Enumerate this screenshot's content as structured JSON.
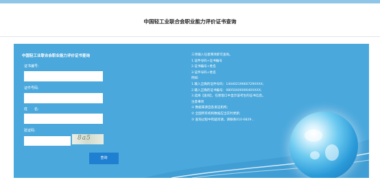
{
  "header": {
    "title": "中国轻工业联合会职业能力评价证书查询"
  },
  "form": {
    "title": "中国轻工业联合会职业能力评价证书查询",
    "fields": [
      {
        "label": "证书编号:",
        "value": ""
      },
      {
        "label": "证件号码:",
        "value": ""
      },
      {
        "label": "姓　　名:",
        "value": ""
      }
    ],
    "captcha_label": "验证码:",
    "captcha_text": "8a5",
    "search_label": "查询"
  },
  "info": {
    "lines": [
      "三项输入任意两项即可查询。",
      "1.证件号码+证书编号",
      "2.证书编号+姓名",
      "3.证件号码+姓名",
      "例如:",
      "1.输入正确的证件号码：14040219660729XXXX;",
      "2.输入正确的证书编号：0805040000040XXXX;",
      "3.选择【查询】，在新窗口中显示该考生的证书信息。",
      "注意事项",
      "① 数据来源自各发证机构;",
      "② 全国所有机构数据应当实时更新;",
      "③ 查询过程中有疑问请，请联系010-6829..."
    ]
  }
}
